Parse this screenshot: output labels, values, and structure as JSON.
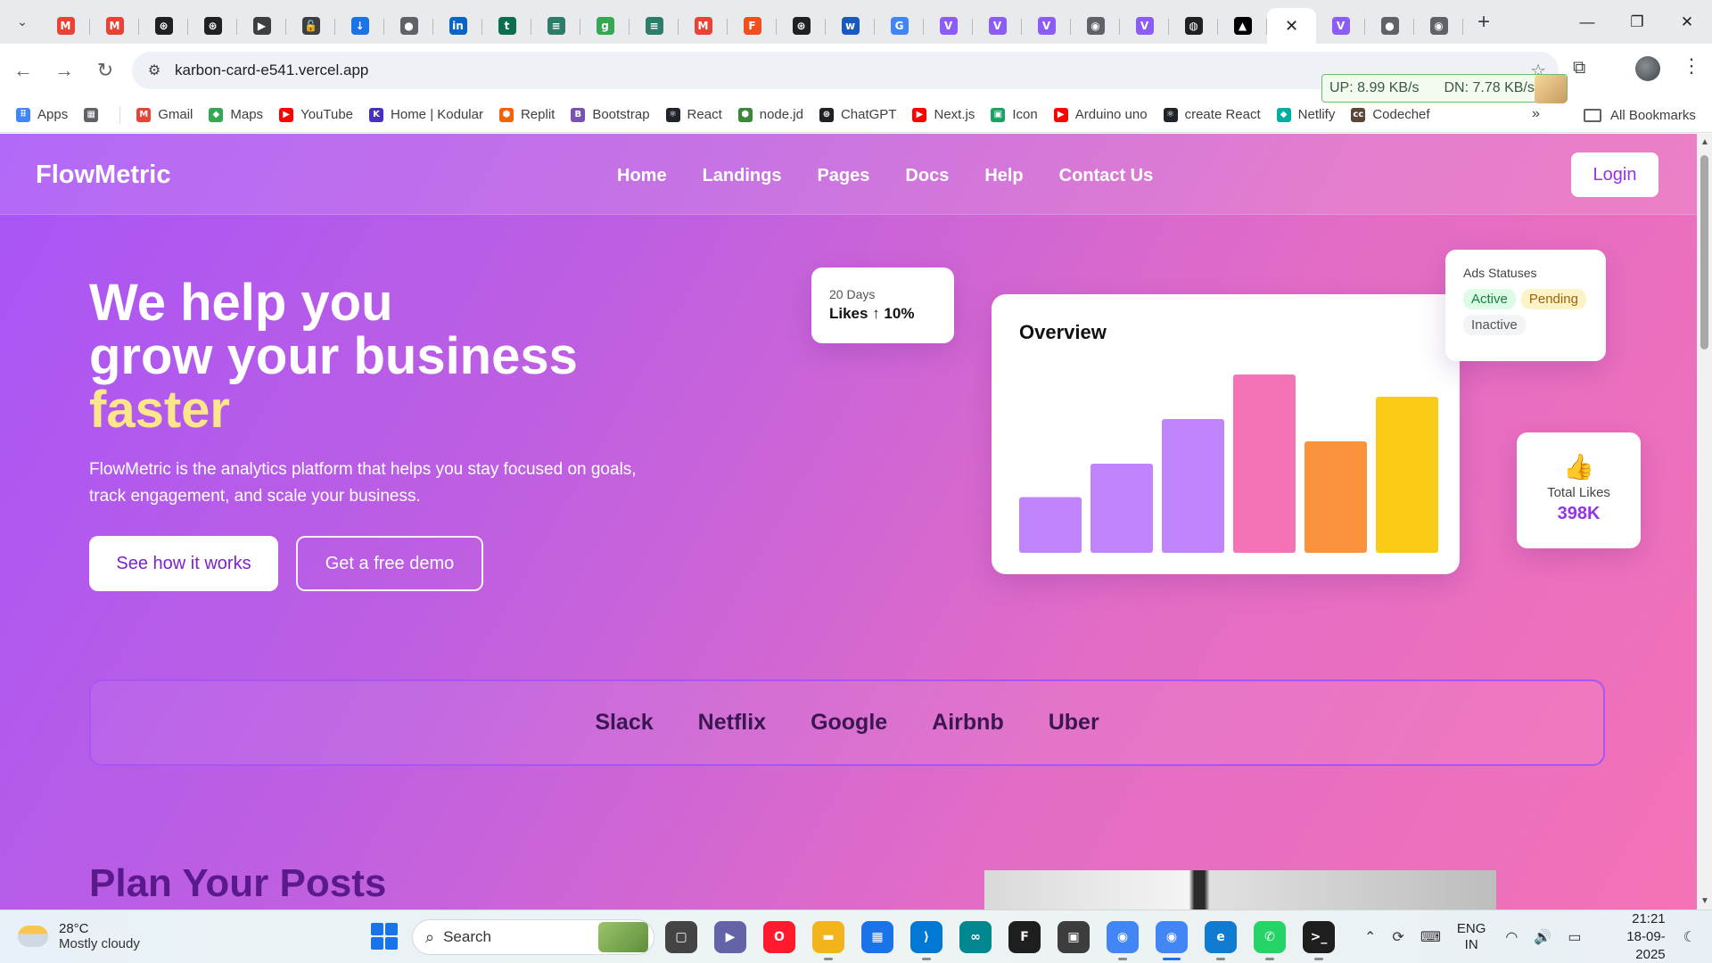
{
  "browser": {
    "tabs": [
      {
        "icon": "gmail-icon",
        "color": "#ea4335",
        "glyph": "M"
      },
      {
        "icon": "gmail-icon",
        "color": "#ea4335",
        "glyph": "M"
      },
      {
        "icon": "openai-icon",
        "color": "#202124",
        "glyph": "⊛"
      },
      {
        "icon": "openai-icon",
        "color": "#202124",
        "glyph": "⊛"
      },
      {
        "icon": "bookmark-icon",
        "color": "#3c4043",
        "glyph": "▶"
      },
      {
        "icon": "lock-icon",
        "color": "#3c4043",
        "glyph": "🔓"
      },
      {
        "icon": "download-icon",
        "color": "#1a73e8",
        "glyph": "↓"
      },
      {
        "icon": "globe-icon",
        "color": "#5f6368",
        "glyph": "●"
      },
      {
        "icon": "linkedin-icon",
        "color": "#0a66c2",
        "glyph": "in"
      },
      {
        "icon": "t-icon",
        "color": "#0b6e4f",
        "glyph": "t"
      },
      {
        "icon": "stripes-icon",
        "color": "#2e7d6b",
        "glyph": "≡"
      },
      {
        "icon": "g-icon",
        "color": "#34a853",
        "glyph": "g"
      },
      {
        "icon": "stripes-icon",
        "color": "#2e7d6b",
        "glyph": "≡"
      },
      {
        "icon": "gmail-icon",
        "color": "#ea4335",
        "glyph": "M"
      },
      {
        "icon": "figma-icon",
        "color": "#f24e1e",
        "glyph": "F"
      },
      {
        "icon": "openai-icon",
        "color": "#202124",
        "glyph": "⊛"
      },
      {
        "icon": "word-icon",
        "color": "#185abd",
        "glyph": "w"
      },
      {
        "icon": "google-icon",
        "color": "#4285f4",
        "glyph": "G"
      },
      {
        "icon": "vite-icon",
        "color": "#8b5cf6",
        "glyph": "V"
      },
      {
        "icon": "vite-icon",
        "color": "#8b5cf6",
        "glyph": "V"
      },
      {
        "icon": "vite-icon",
        "color": "#8b5cf6",
        "glyph": "V"
      },
      {
        "icon": "chrome-icon",
        "color": "#5f6368",
        "glyph": "◉"
      },
      {
        "icon": "vite-icon",
        "color": "#8b5cf6",
        "glyph": "V"
      },
      {
        "icon": "github-icon",
        "color": "#202124",
        "glyph": "◍"
      },
      {
        "icon": "vercel-icon",
        "color": "#000000",
        "glyph": "▲"
      },
      {
        "icon": "close-icon",
        "color": "#ffffff",
        "glyph": "✕",
        "active": true
      },
      {
        "icon": "vite-icon",
        "color": "#8b5cf6",
        "glyph": "V"
      },
      {
        "icon": "globe-icon",
        "color": "#5f6368",
        "glyph": "●"
      },
      {
        "icon": "chrome-icon",
        "color": "#5f6368",
        "glyph": "◉"
      }
    ],
    "url": "karbon-card-e541.vercel.app",
    "netspeed": {
      "up": "UP: 8.99 KB/s",
      "down": "DN: 7.78 KB/s"
    },
    "bookmarks": [
      {
        "label": "Apps",
        "icon": "apps-grid-icon",
        "color": "#4285f4",
        "glyph": "⠿"
      },
      {
        "label": "",
        "icon": "tab-groups-icon",
        "color": "#5f6368",
        "glyph": "▦"
      },
      {
        "label": "Gmail",
        "icon": "gmail-icon",
        "color": "#ea4335",
        "glyph": "M"
      },
      {
        "label": "Maps",
        "icon": "maps-icon",
        "color": "#34a853",
        "glyph": "◆"
      },
      {
        "label": "YouTube",
        "icon": "youtube-icon",
        "color": "#ff0000",
        "glyph": "▶"
      },
      {
        "label": "Home | Kodular",
        "icon": "kodular-icon",
        "color": "#4a2fbd",
        "glyph": "K"
      },
      {
        "label": "Replit",
        "icon": "replit-icon",
        "color": "#f26207",
        "glyph": "⬢"
      },
      {
        "label": "Bootstrap",
        "icon": "bootstrap-icon",
        "color": "#7952b3",
        "glyph": "B"
      },
      {
        "label": "React",
        "icon": "react-icon",
        "color": "#20232a",
        "glyph": "⚛"
      },
      {
        "label": "node.jd",
        "icon": "node-icon",
        "color": "#3c873a",
        "glyph": "⬢"
      },
      {
        "label": "ChatGPT",
        "icon": "openai-icon",
        "color": "#202124",
        "glyph": "⊛"
      },
      {
        "label": "Next.js",
        "icon": "youtube-icon",
        "color": "#ff0000",
        "glyph": "▶"
      },
      {
        "label": "Icon",
        "icon": "icon-site-icon",
        "color": "#1aa260",
        "glyph": "▣"
      },
      {
        "label": "Arduino uno",
        "icon": "youtube-icon",
        "color": "#ff0000",
        "glyph": "▶"
      },
      {
        "label": "create React",
        "icon": "react-icon",
        "color": "#20232a",
        "glyph": "⚛"
      },
      {
        "label": "Netlify",
        "icon": "netlify-icon",
        "color": "#00ad9f",
        "glyph": "◆"
      },
      {
        "label": "Codechef",
        "icon": "codechef-icon",
        "color": "#5b4638",
        "glyph": "cc"
      }
    ],
    "all_bookmarks": "All Bookmarks"
  },
  "site": {
    "brand": "FlowMetric",
    "nav": [
      "Home",
      "Landings",
      "Pages",
      "Docs",
      "Help",
      "Contact Us"
    ],
    "login": "Login",
    "hero": {
      "line1": "We help you",
      "line2": "grow your business",
      "highlight": "faster",
      "subtitle": "FlowMetric is the analytics platform that helps you stay focused on goals, track engagement, and scale your business.",
      "cta_primary": "See how it works",
      "cta_secondary": "Get a free demo"
    },
    "likes_card": {
      "period": "20 Days",
      "stat": "Likes ↑ 10%"
    },
    "overview": {
      "title": "Overview"
    },
    "ads": {
      "title": "Ads Statuses",
      "badges": [
        "Active",
        "Pending",
        "Inactive"
      ]
    },
    "total_likes": {
      "label": "Total Likes",
      "value": "398K",
      "icon": "thumbs-up-icon"
    },
    "logos": [
      "Slack",
      "Netflix",
      "Google",
      "Airbnb",
      "Uber"
    ],
    "section_title": "Plan Your Posts"
  },
  "chart_data": {
    "type": "bar",
    "categories": [
      "",
      "",
      "",
      "",
      "",
      ""
    ],
    "values": [
      25,
      40,
      60,
      80,
      50,
      70
    ],
    "colors": [
      "#c084fc",
      "#c084fc",
      "#c084fc",
      "#f472b6",
      "#fb923c",
      "#facc15"
    ],
    "title": "Overview",
    "ylim": [
      0,
      80
    ]
  },
  "taskbar": {
    "temp": "28°C",
    "weather": "Mostly cloudy",
    "search": "Search",
    "apps": [
      {
        "icon": "task-view-icon",
        "color": "#444444",
        "glyph": "▢"
      },
      {
        "icon": "teams-icon",
        "color": "#6264a7",
        "glyph": "▶"
      },
      {
        "icon": "opera-icon",
        "color": "#ff1b2d",
        "glyph": "O"
      },
      {
        "icon": "file-explorer-icon",
        "color": "#f3b41b",
        "glyph": "▬"
      },
      {
        "icon": "store-icon",
        "color": "#1a73e8",
        "glyph": "▦"
      },
      {
        "icon": "vscode-icon",
        "color": "#0078d4",
        "glyph": "⟩"
      },
      {
        "icon": "arduino-icon",
        "color": "#00878f",
        "glyph": "∞"
      },
      {
        "icon": "figma-icon",
        "color": "#1e1e1e",
        "glyph": "F"
      },
      {
        "icon": "app-icon",
        "color": "#3d3d3d",
        "glyph": "▣"
      },
      {
        "icon": "chrome-icon",
        "color": "#4285f4",
        "glyph": "◉"
      },
      {
        "icon": "chrome-icon",
        "color": "#4285f4",
        "glyph": "◉"
      },
      {
        "icon": "edge-icon",
        "color": "#0f7bd1",
        "glyph": "e"
      },
      {
        "icon": "whatsapp-icon",
        "color": "#25d366",
        "glyph": "✆"
      },
      {
        "icon": "terminal-icon",
        "color": "#1e1e1e",
        "glyph": ">_"
      }
    ],
    "lang": "ENG",
    "region": "IN",
    "time": "21:21",
    "date": "18-09-2025"
  }
}
